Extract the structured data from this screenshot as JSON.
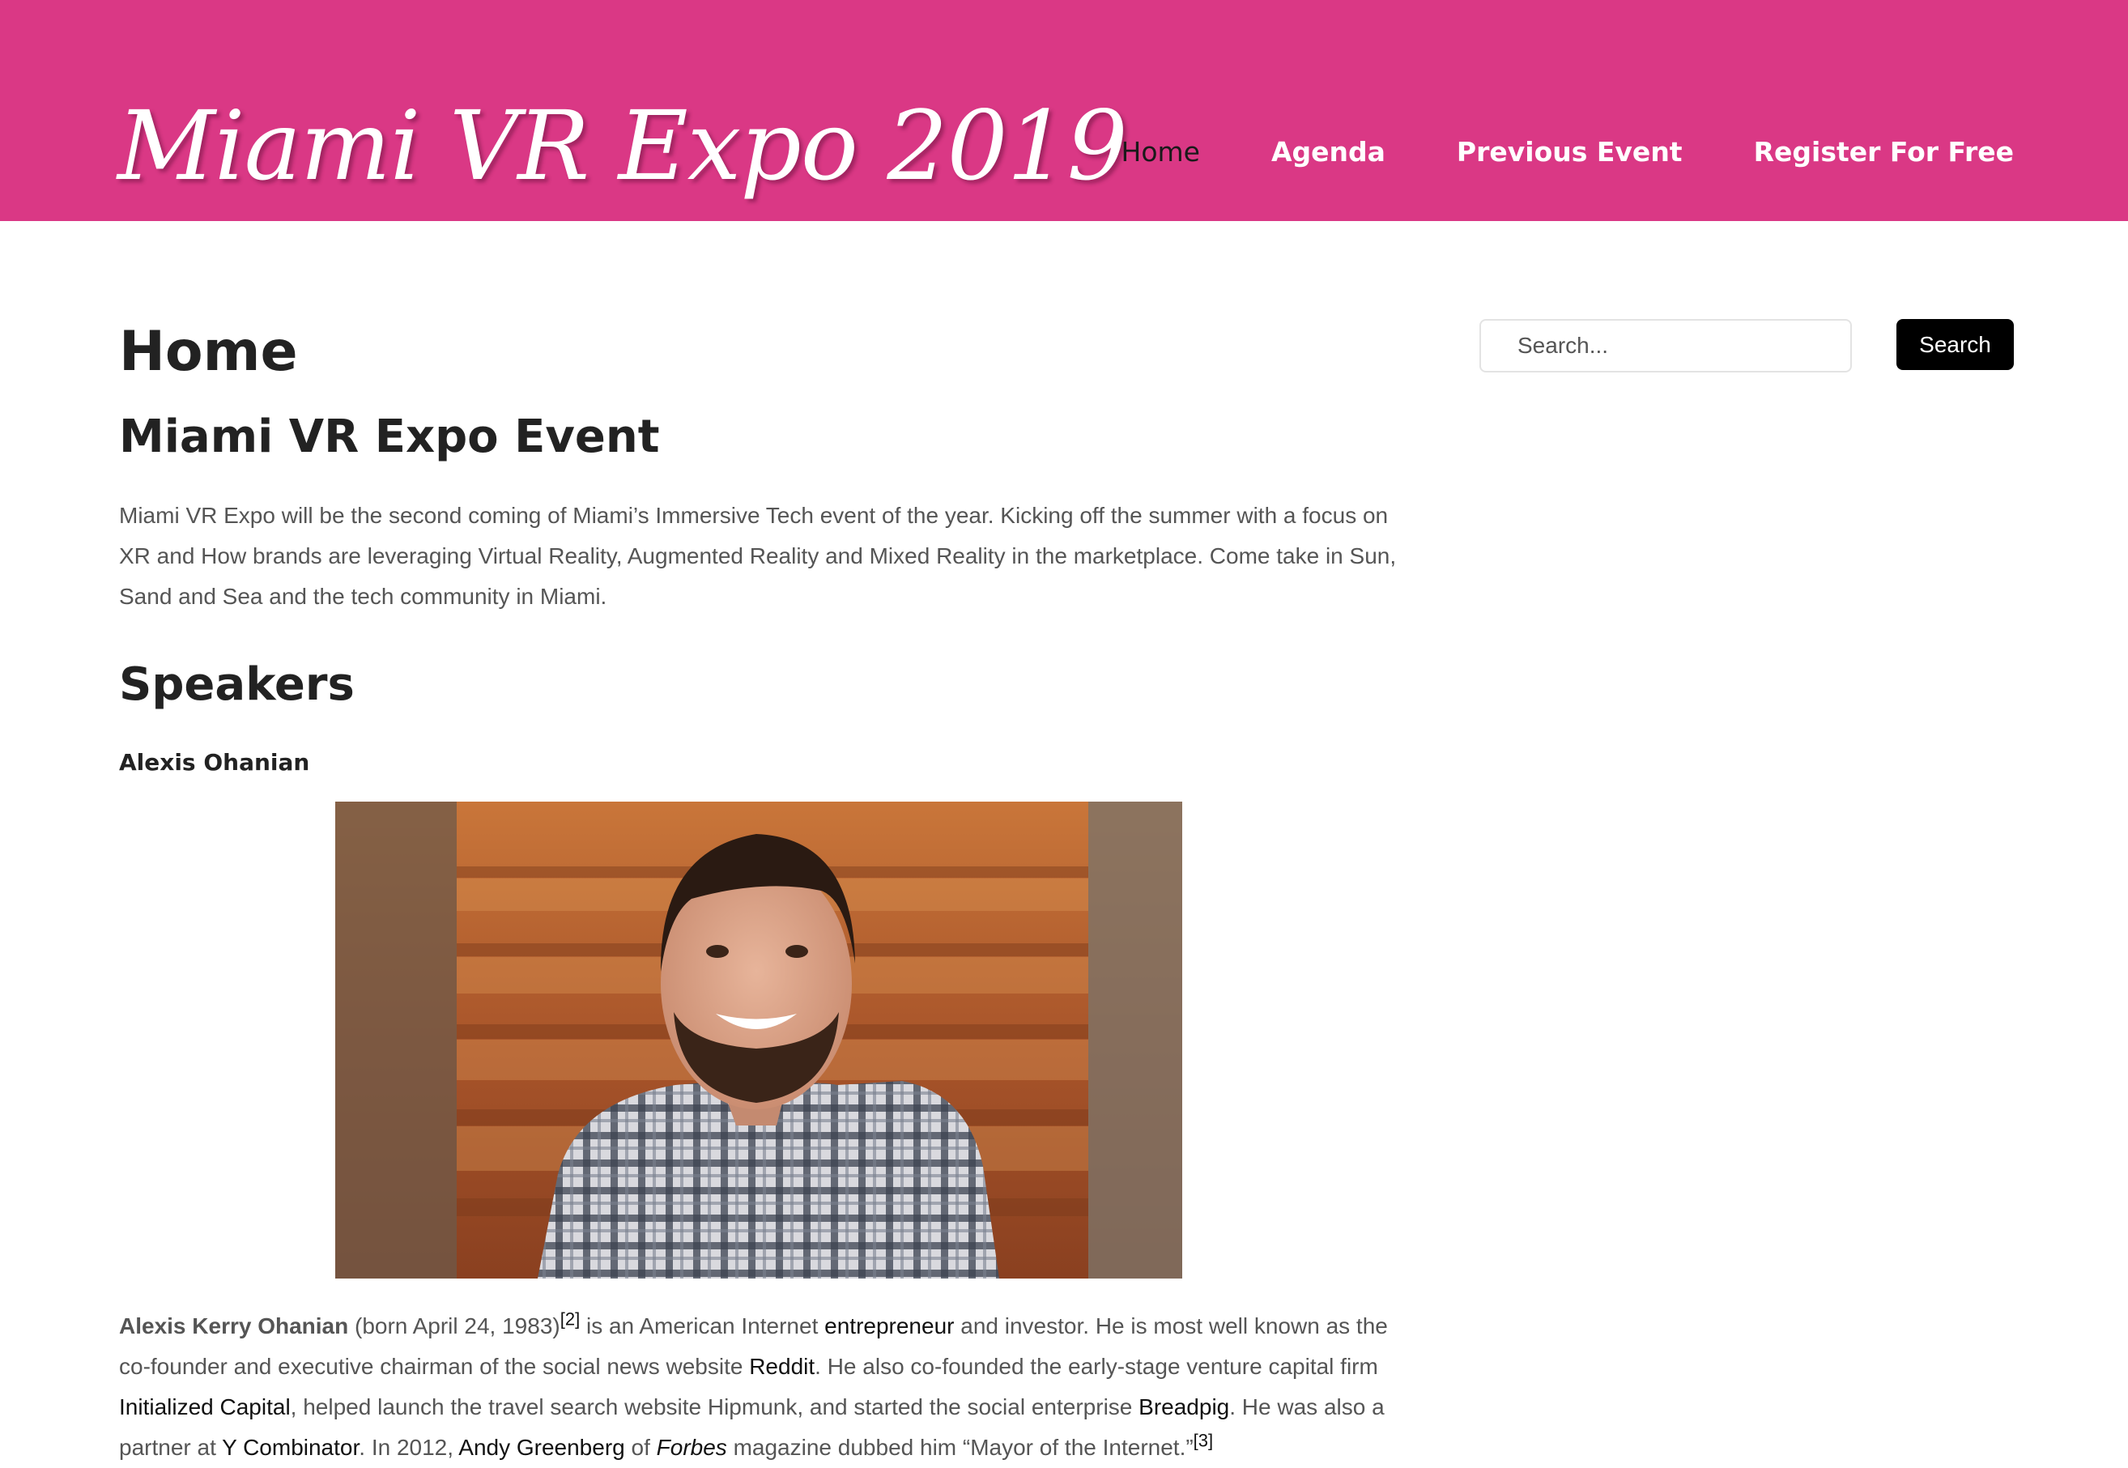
{
  "site": {
    "title": "Miami VR Expo 2019"
  },
  "nav": {
    "items": [
      {
        "label": "Home"
      },
      {
        "label": "Agenda"
      },
      {
        "label": "Previous Event"
      },
      {
        "label": "Register For Free"
      }
    ]
  },
  "page": {
    "title": "Home",
    "event_heading": "Miami VR Expo Event",
    "intro": "Miami VR Expo will be the second coming of Miami’s Immersive Tech event of the year. Kicking off the summer with a focus on XR and How brands are leveraging Virtual Reality, Augmented Reality and Mixed Reality in the marketplace. Come take in Sun, Sand and Sea and the tech community in Miami.",
    "speakers_heading": "Speakers",
    "speaker": {
      "name": "Alexis Ohanian",
      "bio": {
        "full_name": "Alexis Kerry Ohanian",
        "born": " (born April 24, 1983)",
        "ref2": "[2]",
        "t1": " is an American Internet ",
        "link_entrepreneur": "entrepreneur",
        "t2": " and investor. He is most well known as the co-founder and executive chairman of the social news website ",
        "link_reddit": "Reddit",
        "t3": ". He also co-founded the early-stage venture capital firm ",
        "link_initialized": "Initialized Capital",
        "t4": ", helped launch the travel search website Hipmunk, and started the social enterprise ",
        "link_breadpig": "Breadpig",
        "t5": ". He was also a partner at ",
        "link_yc": "Y Combinator",
        "t6": ". In 2012, ",
        "link_greenberg": "Andy Greenberg",
        "t7": " of ",
        "link_forbes": "Forbes",
        "t8": " magazine dubbed him “Mayor of the Internet.”",
        "ref3": "[3]"
      }
    }
  },
  "search": {
    "placeholder": "Search...",
    "button_label": "Search"
  },
  "colors": {
    "header": "#da3885",
    "text": "#555555",
    "heading": "#222222",
    "button": "#000000"
  }
}
